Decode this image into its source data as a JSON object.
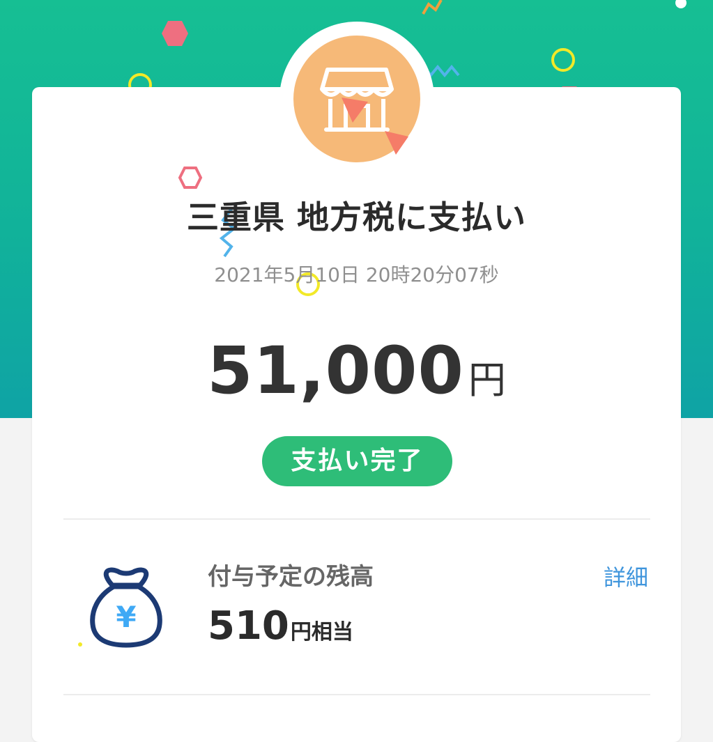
{
  "payment": {
    "title": "三重県 地方税に支払い",
    "timestamp": "2021年5月10日 20時20分07秒",
    "amount": "51,000",
    "currency": "円",
    "status": "支払い完了",
    "store_icon": "store-icon"
  },
  "reward": {
    "label": "付与予定の残高",
    "amount": "510",
    "unit": "円相当",
    "detail_link": "詳細",
    "icon": "money-bag-yen-icon"
  },
  "colors": {
    "header_green": "#16bf93",
    "header_teal": "#0fa3a5",
    "status_green": "#2ebd78",
    "link_blue": "#3f95dc",
    "store_circle": "#f6b978"
  }
}
